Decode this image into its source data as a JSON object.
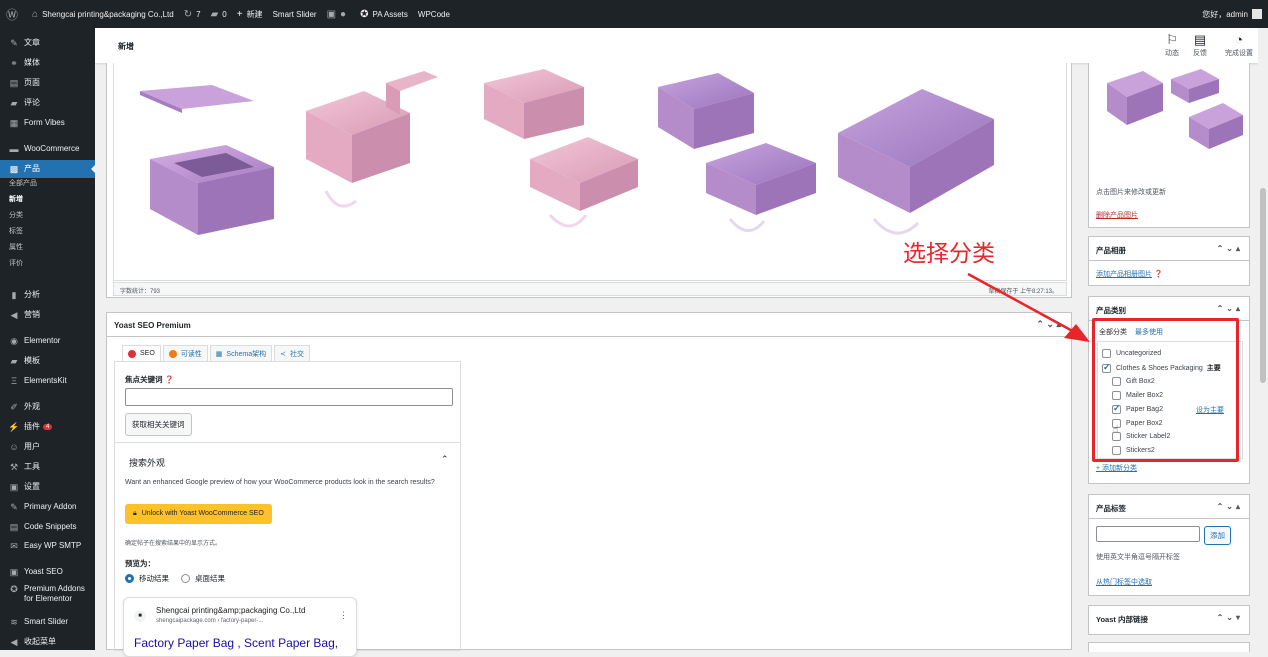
{
  "adminbar": {
    "site_name": "Shengcai printing&packaging Co.,Ltd",
    "updates": "7",
    "comments": "0",
    "new": "新建",
    "smart_slider": "Smart Slider",
    "pa_assets": "PA Assets",
    "wpcode": "WPCode",
    "greeting": "您好，admin"
  },
  "sidebar": {
    "items": [
      {
        "label": "文章",
        "icon": "pin-icon"
      },
      {
        "label": "媒体",
        "icon": "media-icon"
      },
      {
        "label": "页面",
        "icon": "page-icon"
      },
      {
        "label": "评论",
        "icon": "comment-icon"
      },
      {
        "label": "Form Vibes",
        "icon": "form-icon"
      },
      {
        "label": "WooCommerce",
        "icon": "woo-icon"
      },
      {
        "label": "产品",
        "icon": "product-icon"
      },
      {
        "label": "分析",
        "icon": "chart-icon"
      },
      {
        "label": "营销",
        "icon": "megaphone-icon"
      },
      {
        "label": "Elementor",
        "icon": "elementor-icon"
      },
      {
        "label": "模板",
        "icon": "folder-icon"
      },
      {
        "label": "ElementsKit",
        "icon": "ek-icon"
      },
      {
        "label": "外观",
        "icon": "brush-icon"
      },
      {
        "label": "插件",
        "icon": "plugin-icon",
        "badge": "4"
      },
      {
        "label": "用户",
        "icon": "user-icon"
      },
      {
        "label": "工具",
        "icon": "wrench-icon"
      },
      {
        "label": "设置",
        "icon": "settings-icon"
      },
      {
        "label": "Primary Addon",
        "icon": "addon-icon"
      },
      {
        "label": "Code Snippets",
        "icon": "code-icon"
      },
      {
        "label": "Easy WP SMTP",
        "icon": "mail-icon"
      },
      {
        "label": "Yoast SEO",
        "icon": "yoast-icon"
      },
      {
        "label": "Premium Addons for Elementor",
        "icon": "premium-icon"
      },
      {
        "label": "Smart Slider",
        "icon": "slider-icon"
      },
      {
        "label": "收起菜单",
        "icon": "collapse-icon"
      }
    ],
    "submenu": [
      "全部产品",
      "新增",
      "分类",
      "标签",
      "属性",
      "评价"
    ]
  },
  "topbar": {
    "title": "新增",
    "buttons": [
      "动态",
      "反馈",
      "完成设置"
    ]
  },
  "editor": {
    "word_count": "字数统计：793",
    "saved": "草稿保存于 上午8:27:13。"
  },
  "yoast": {
    "title": "Yoast SEO Premium",
    "tabs": [
      "SEO",
      "可读性",
      "Schema架构",
      "社交"
    ],
    "focus_keyword_label": "焦点关键词",
    "get_keywords_button": "获取相关关键词",
    "search_appearance": "搜索外观",
    "preview_promo": "Want an enhanced Google preview of how your WooCommerce products look in the search results?",
    "unlock_button": "Unlock with Yoast WooCommerce SEO",
    "hint": "确定帖子在搜索结果中的显示方式。",
    "preview_as": "预览为：",
    "mobile": "移动结果",
    "desktop": "桌面结果",
    "card_site": "Shengcai printing&amp;packaging Co.,Ltd",
    "card_url": "shengcaipackage.com › factory-paper-...",
    "card_title": "Factory Paper Bag , Scent Paper Bag,"
  },
  "product_image": {
    "hint": "点击图片来修改或更新",
    "remove": "删除产品图片"
  },
  "gallery": {
    "title": "产品相册",
    "add": "添加产品相册图片"
  },
  "categories": {
    "title": "产品类别",
    "tab_all": "全部分类",
    "tab_most": "最多使用",
    "items": [
      {
        "label": "Uncategorized",
        "checked": false,
        "level": 0
      },
      {
        "label": "Clothes & Shoes Packaging",
        "checked": true,
        "level": 0,
        "tag": "主要"
      },
      {
        "label": "Gift Box2",
        "checked": false,
        "level": 1
      },
      {
        "label": "Mailer Box2",
        "checked": false,
        "level": 1
      },
      {
        "label": "Paper Bag2",
        "checked": true,
        "level": 1,
        "action": "设为主要"
      },
      {
        "label": "Paper Box2",
        "checked": false,
        "level": 1
      },
      {
        "label": "Sticker Label2",
        "checked": false,
        "level": 1
      },
      {
        "label": "Stickers2",
        "checked": false,
        "level": 1
      }
    ],
    "add_new": "+ 添加新分类"
  },
  "tags": {
    "title": "产品标签",
    "add_button": "添加",
    "hint": "使用英文半角逗号隔开标签",
    "choose": "从热门标签中选取"
  },
  "yoast_links": {
    "title": "Yoast 内部链接"
  },
  "annotation": {
    "text": "选择分类",
    "color": "#e8252a"
  },
  "colors": {
    "admin_dark": "#1d2327",
    "accent": "#2271b1"
  }
}
